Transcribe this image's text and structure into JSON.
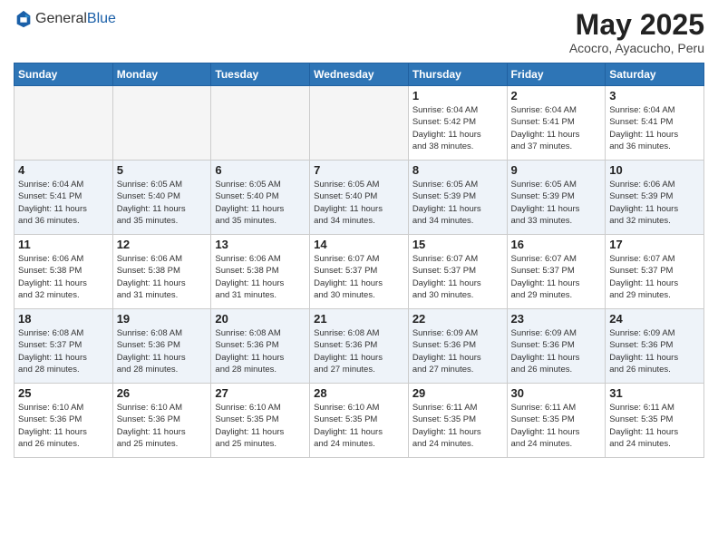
{
  "header": {
    "logo_general": "General",
    "logo_blue": "Blue",
    "month_title": "May 2025",
    "subtitle": "Acocro, Ayacucho, Peru"
  },
  "calendar": {
    "days_of_week": [
      "Sunday",
      "Monday",
      "Tuesday",
      "Wednesday",
      "Thursday",
      "Friday",
      "Saturday"
    ],
    "weeks": [
      {
        "row_class": "row-white",
        "days": [
          {
            "num": "",
            "info": "",
            "empty": true
          },
          {
            "num": "",
            "info": "",
            "empty": true
          },
          {
            "num": "",
            "info": "",
            "empty": true
          },
          {
            "num": "",
            "info": "",
            "empty": true
          },
          {
            "num": "1",
            "info": "Sunrise: 6:04 AM\nSunset: 5:42 PM\nDaylight: 11 hours\nand 38 minutes.",
            "empty": false
          },
          {
            "num": "2",
            "info": "Sunrise: 6:04 AM\nSunset: 5:41 PM\nDaylight: 11 hours\nand 37 minutes.",
            "empty": false
          },
          {
            "num": "3",
            "info": "Sunrise: 6:04 AM\nSunset: 5:41 PM\nDaylight: 11 hours\nand 36 minutes.",
            "empty": false
          }
        ]
      },
      {
        "row_class": "row-blue",
        "days": [
          {
            "num": "4",
            "info": "Sunrise: 6:04 AM\nSunset: 5:41 PM\nDaylight: 11 hours\nand 36 minutes.",
            "empty": false
          },
          {
            "num": "5",
            "info": "Sunrise: 6:05 AM\nSunset: 5:40 PM\nDaylight: 11 hours\nand 35 minutes.",
            "empty": false
          },
          {
            "num": "6",
            "info": "Sunrise: 6:05 AM\nSunset: 5:40 PM\nDaylight: 11 hours\nand 35 minutes.",
            "empty": false
          },
          {
            "num": "7",
            "info": "Sunrise: 6:05 AM\nSunset: 5:40 PM\nDaylight: 11 hours\nand 34 minutes.",
            "empty": false
          },
          {
            "num": "8",
            "info": "Sunrise: 6:05 AM\nSunset: 5:39 PM\nDaylight: 11 hours\nand 34 minutes.",
            "empty": false
          },
          {
            "num": "9",
            "info": "Sunrise: 6:05 AM\nSunset: 5:39 PM\nDaylight: 11 hours\nand 33 minutes.",
            "empty": false
          },
          {
            "num": "10",
            "info": "Sunrise: 6:06 AM\nSunset: 5:39 PM\nDaylight: 11 hours\nand 32 minutes.",
            "empty": false
          }
        ]
      },
      {
        "row_class": "row-white",
        "days": [
          {
            "num": "11",
            "info": "Sunrise: 6:06 AM\nSunset: 5:38 PM\nDaylight: 11 hours\nand 32 minutes.",
            "empty": false
          },
          {
            "num": "12",
            "info": "Sunrise: 6:06 AM\nSunset: 5:38 PM\nDaylight: 11 hours\nand 31 minutes.",
            "empty": false
          },
          {
            "num": "13",
            "info": "Sunrise: 6:06 AM\nSunset: 5:38 PM\nDaylight: 11 hours\nand 31 minutes.",
            "empty": false
          },
          {
            "num": "14",
            "info": "Sunrise: 6:07 AM\nSunset: 5:37 PM\nDaylight: 11 hours\nand 30 minutes.",
            "empty": false
          },
          {
            "num": "15",
            "info": "Sunrise: 6:07 AM\nSunset: 5:37 PM\nDaylight: 11 hours\nand 30 minutes.",
            "empty": false
          },
          {
            "num": "16",
            "info": "Sunrise: 6:07 AM\nSunset: 5:37 PM\nDaylight: 11 hours\nand 29 minutes.",
            "empty": false
          },
          {
            "num": "17",
            "info": "Sunrise: 6:07 AM\nSunset: 5:37 PM\nDaylight: 11 hours\nand 29 minutes.",
            "empty": false
          }
        ]
      },
      {
        "row_class": "row-blue",
        "days": [
          {
            "num": "18",
            "info": "Sunrise: 6:08 AM\nSunset: 5:37 PM\nDaylight: 11 hours\nand 28 minutes.",
            "empty": false
          },
          {
            "num": "19",
            "info": "Sunrise: 6:08 AM\nSunset: 5:36 PM\nDaylight: 11 hours\nand 28 minutes.",
            "empty": false
          },
          {
            "num": "20",
            "info": "Sunrise: 6:08 AM\nSunset: 5:36 PM\nDaylight: 11 hours\nand 28 minutes.",
            "empty": false
          },
          {
            "num": "21",
            "info": "Sunrise: 6:08 AM\nSunset: 5:36 PM\nDaylight: 11 hours\nand 27 minutes.",
            "empty": false
          },
          {
            "num": "22",
            "info": "Sunrise: 6:09 AM\nSunset: 5:36 PM\nDaylight: 11 hours\nand 27 minutes.",
            "empty": false
          },
          {
            "num": "23",
            "info": "Sunrise: 6:09 AM\nSunset: 5:36 PM\nDaylight: 11 hours\nand 26 minutes.",
            "empty": false
          },
          {
            "num": "24",
            "info": "Sunrise: 6:09 AM\nSunset: 5:36 PM\nDaylight: 11 hours\nand 26 minutes.",
            "empty": false
          }
        ]
      },
      {
        "row_class": "row-white",
        "days": [
          {
            "num": "25",
            "info": "Sunrise: 6:10 AM\nSunset: 5:36 PM\nDaylight: 11 hours\nand 26 minutes.",
            "empty": false
          },
          {
            "num": "26",
            "info": "Sunrise: 6:10 AM\nSunset: 5:36 PM\nDaylight: 11 hours\nand 25 minutes.",
            "empty": false
          },
          {
            "num": "27",
            "info": "Sunrise: 6:10 AM\nSunset: 5:35 PM\nDaylight: 11 hours\nand 25 minutes.",
            "empty": false
          },
          {
            "num": "28",
            "info": "Sunrise: 6:10 AM\nSunset: 5:35 PM\nDaylight: 11 hours\nand 24 minutes.",
            "empty": false
          },
          {
            "num": "29",
            "info": "Sunrise: 6:11 AM\nSunset: 5:35 PM\nDaylight: 11 hours\nand 24 minutes.",
            "empty": false
          },
          {
            "num": "30",
            "info": "Sunrise: 6:11 AM\nSunset: 5:35 PM\nDaylight: 11 hours\nand 24 minutes.",
            "empty": false
          },
          {
            "num": "31",
            "info": "Sunrise: 6:11 AM\nSunset: 5:35 PM\nDaylight: 11 hours\nand 24 minutes.",
            "empty": false
          }
        ]
      }
    ]
  }
}
